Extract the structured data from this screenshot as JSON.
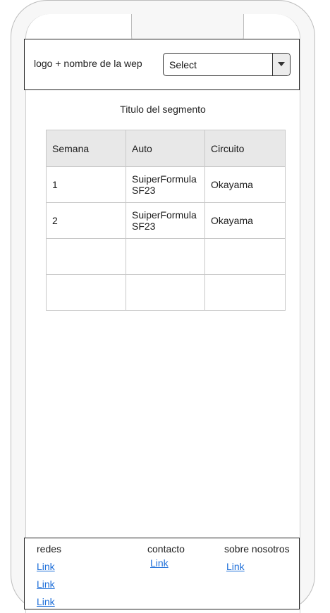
{
  "header": {
    "brand": "logo + nombre de la wep",
    "select": {
      "value": "Select"
    }
  },
  "segment": {
    "title": "Titulo del segmento"
  },
  "table": {
    "headers": [
      "Semana",
      "Auto",
      "Circuito"
    ],
    "rows": [
      [
        "1",
        "SuiperFormula SF23",
        "Okayama"
      ],
      [
        "2",
        "SuiperFormula SF23",
        "Okayama"
      ],
      [
        "",
        "",
        ""
      ],
      [
        "",
        "",
        ""
      ]
    ]
  },
  "footer": {
    "redes": {
      "title": "redes",
      "links": [
        "Link",
        "Link",
        "Link"
      ]
    },
    "contacto": {
      "title": "contacto",
      "links": [
        "Link"
      ]
    },
    "sobre": {
      "title": "sobre nosotros",
      "links": [
        "Link"
      ]
    }
  }
}
